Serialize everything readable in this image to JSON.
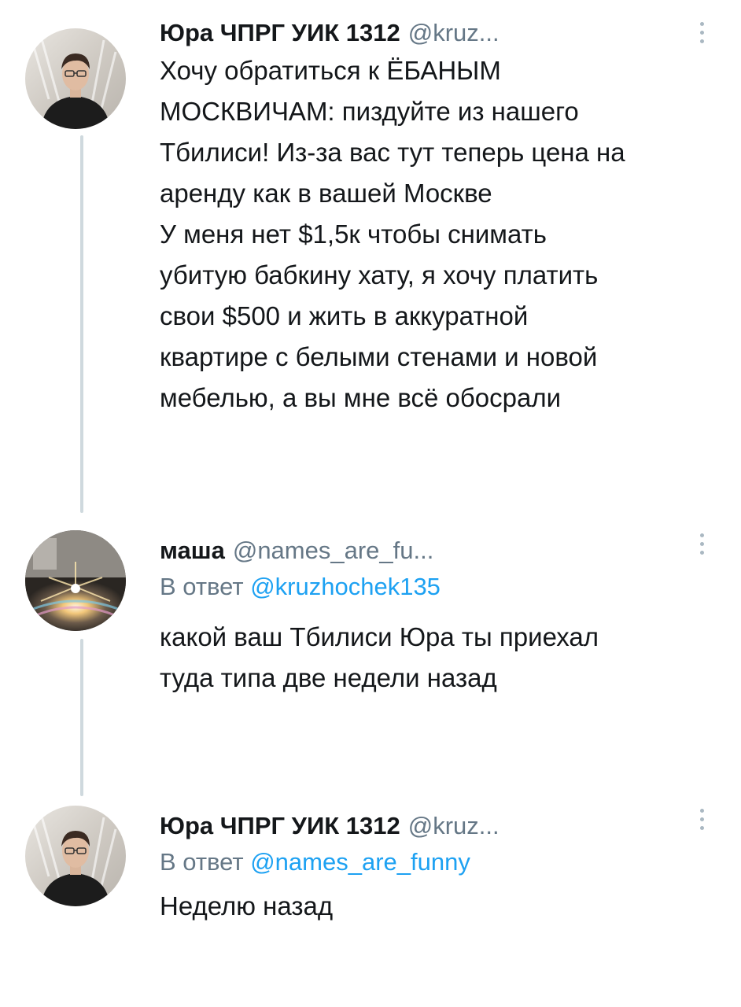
{
  "tweets": [
    {
      "name": "Юра ЧПРГ УИК 1312",
      "handle": "@kruz...",
      "text": "Хочу обратиться к ЁБАНЫМ\nМОСКВИЧАМ: пиздуйте из нашего\nТбилиси! Из-за вас тут теперь цена на\nаренду как в вашей Москве\nУ меня нет $1,5к чтобы снимать\nубитую бабкину хату, я хочу платить\nсвои $500 и жить в аккуратной\nквартире с белыми стенами и новой\nмебелью, а вы мне всё обосрали"
    },
    {
      "name": "маша",
      "handle": "@names_are_fu...",
      "reply_prefix": "В ответ",
      "reply_mention": "@kruzhochek135",
      "text": "какой ваш Тбилиси Юра ты приехал\nтуда типа две недели назад"
    },
    {
      "name": "Юра ЧПРГ УИК 1312",
      "handle": "@kruz...",
      "reply_prefix": "В ответ",
      "reply_mention": "@names_are_funny",
      "text": "Неделю назад"
    }
  ],
  "colors": {
    "text": "#14171a",
    "secondary": "#657786",
    "link": "#1da1f2",
    "thread_line": "#cfd9de"
  }
}
